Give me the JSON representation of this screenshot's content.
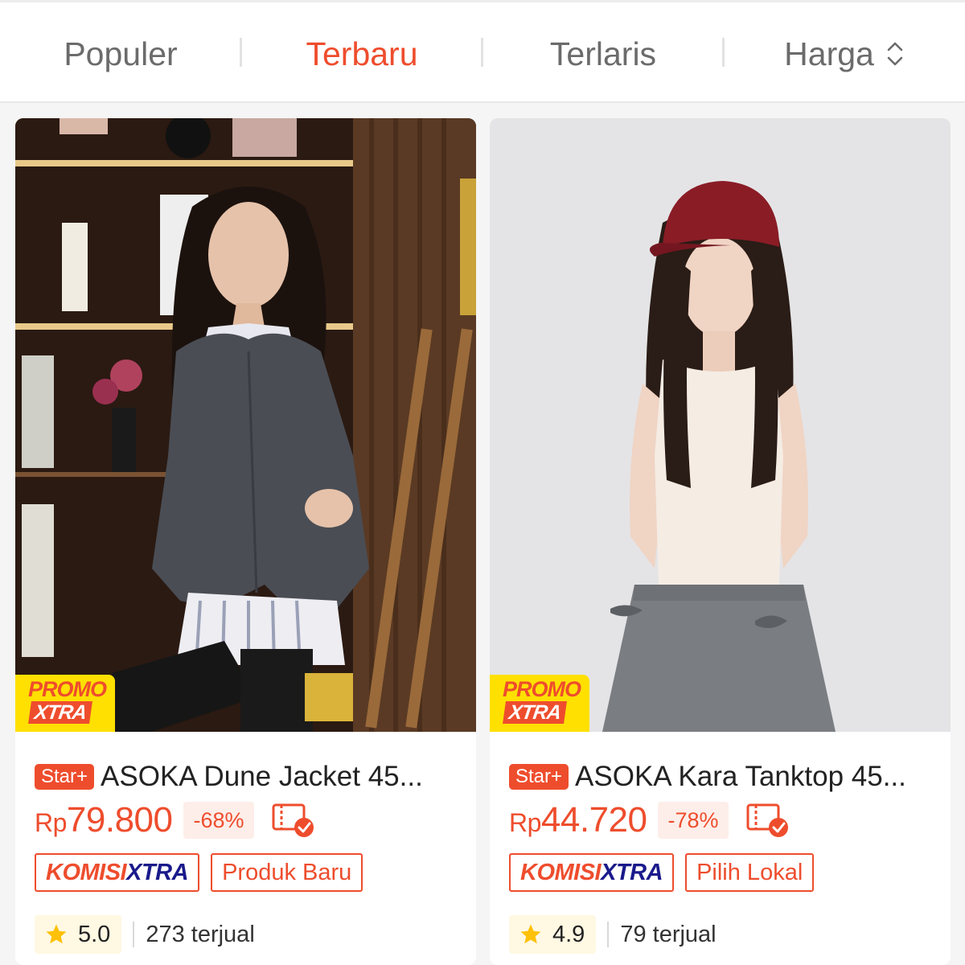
{
  "sort_tabs": [
    {
      "label": "Populer",
      "active": false
    },
    {
      "label": "Terbaru",
      "active": true
    },
    {
      "label": "Terlaris",
      "active": false
    },
    {
      "label": "Harga",
      "active": false
    }
  ],
  "colors": {
    "accent": "#ee4d2d",
    "promo_yellow": "#ffe000",
    "star": "#ffc107"
  },
  "products": [
    {
      "badge": "Star+",
      "title": "ASOKA Dune Jacket 45...",
      "currency": "Rp",
      "price": "79.800",
      "discount": "-68%",
      "promo_line1": "PROMO",
      "promo_line2": "XTRA",
      "tags": {
        "komisi_a": "KOMISI",
        "komisi_b": "XTRA",
        "label": "Produk Baru"
      },
      "rating": "5.0",
      "sold": "273 terjual",
      "icons": [
        "free-shipping-icon",
        "star-icon"
      ]
    },
    {
      "badge": "Star+",
      "title": "ASOKA Kara Tanktop 45...",
      "currency": "Rp",
      "price": "44.720",
      "discount": "-78%",
      "promo_line1": "PROMO",
      "promo_line2": "XTRA",
      "tags": {
        "komisi_a": "KOMISI",
        "komisi_b": "XTRA",
        "label": "Pilih Lokal"
      },
      "rating": "4.9",
      "sold": "79 terjual",
      "icons": [
        "free-shipping-icon",
        "star-icon"
      ]
    }
  ]
}
